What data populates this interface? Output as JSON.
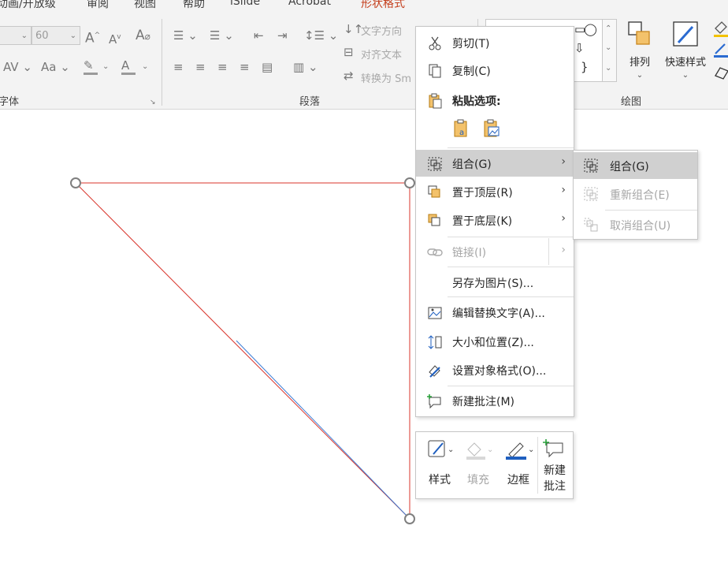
{
  "ribbon": {
    "tabs": [
      {
        "label": "动画/开放级"
      },
      {
        "label": "审阅"
      },
      {
        "label": "视图"
      },
      {
        "label": "帮助"
      },
      {
        "label": "iSlide"
      },
      {
        "label": "Acrobat"
      },
      {
        "label": "形状格式"
      }
    ],
    "font_size_value": "60",
    "text_direction": "文字方向",
    "align_text": "对齐文本",
    "convert_smartart": "转换为 Sm",
    "arrange_label": "排列",
    "quick_styles_label": "快速样式",
    "groups": {
      "font": "字体",
      "paragraph": "段落",
      "drawing": "绘图"
    }
  },
  "context_menu": {
    "cut": "剪切(T)",
    "copy": "复制(C)",
    "paste_options": "粘贴选项:",
    "group": "组合(G)",
    "bring_to_front": "置于顶层(R)",
    "send_to_back": "置于底层(K)",
    "link": "链接(I)",
    "save_as_picture": "另存为图片(S)...",
    "edit_alt_text": "编辑替换文字(A)...",
    "size_position": "大小和位置(Z)...",
    "format_object": "设置对象格式(O)...",
    "new_comment": "新建批注(M)"
  },
  "submenu": {
    "group": "组合(G)",
    "regroup": "重新组合(E)",
    "ungroup": "取消组合(U)"
  },
  "mini_toolbar": {
    "style": "样式",
    "fill": "填充",
    "outline": "边框",
    "new_comment_line1": "新建",
    "new_comment_line2": "批注"
  },
  "colors": {
    "accent_red": "#c43e1c",
    "line_red": "#d9342b",
    "line_blue": "#3a7bd5",
    "handle": "#7f7f7f",
    "icon_orange": "#e8a33d"
  }
}
